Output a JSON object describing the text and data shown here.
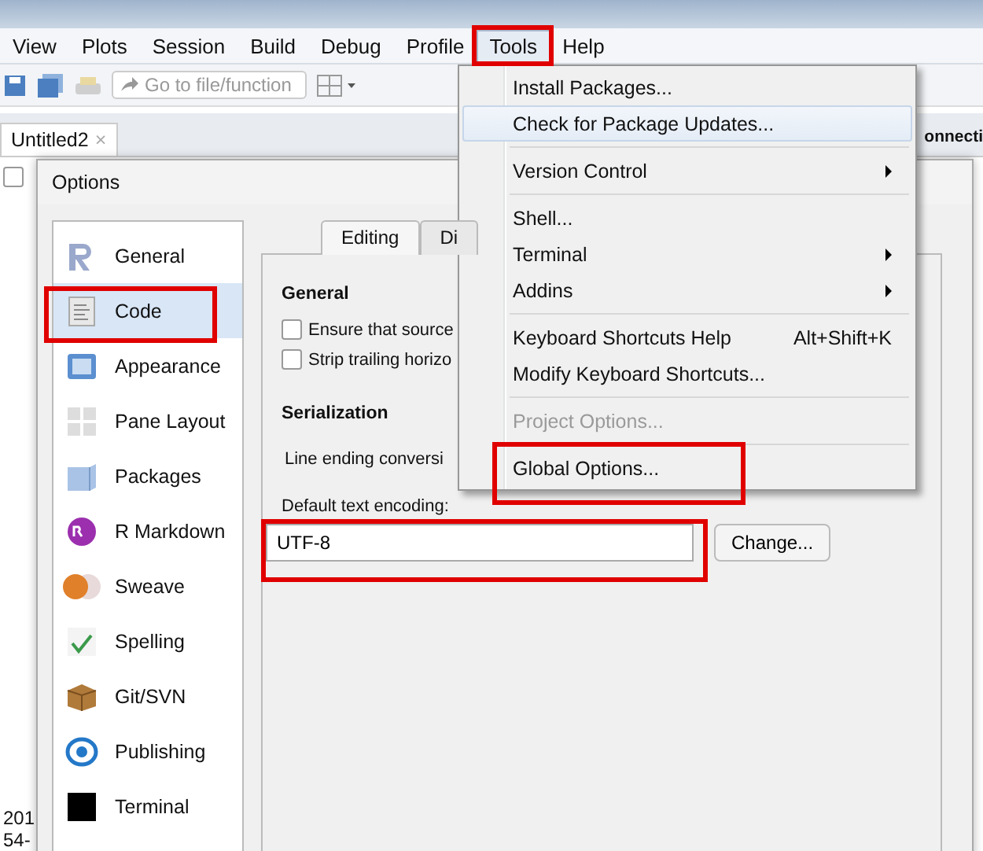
{
  "menubar": {
    "items": [
      {
        "label": "View",
        "selected": false,
        "highlighted": false
      },
      {
        "label": "Plots",
        "selected": false,
        "highlighted": false
      },
      {
        "label": "Session",
        "selected": false,
        "highlighted": false
      },
      {
        "label": "Build",
        "selected": false,
        "highlighted": false
      },
      {
        "label": "Debug",
        "selected": false,
        "highlighted": false
      },
      {
        "label": "Profile",
        "selected": false,
        "highlighted": false
      },
      {
        "label": "Tools",
        "selected": true,
        "highlighted": true
      },
      {
        "label": "Help",
        "selected": false,
        "highlighted": false
      }
    ]
  },
  "toolbar": {
    "goto_field": {
      "placeholder": "Go to file/function"
    }
  },
  "editor_tabs": [
    {
      "label": "Untitled2",
      "close": "×"
    }
  ],
  "right_pane_tab": "onnecti",
  "editor_row": {
    "checked": false
  },
  "console_fragments": [
    "201",
    "54-"
  ],
  "dialog": {
    "title": "Options",
    "sidebar": [
      {
        "label": "General",
        "kind": "general",
        "selected": false,
        "highlighted": false
      },
      {
        "label": "Code",
        "kind": "code",
        "selected": true,
        "highlighted": true
      },
      {
        "label": "Appearance",
        "kind": "appearance",
        "selected": false,
        "highlighted": false
      },
      {
        "label": "Pane Layout",
        "kind": "panes",
        "selected": false,
        "highlighted": false
      },
      {
        "label": "Packages",
        "kind": "packages",
        "selected": false,
        "highlighted": false
      },
      {
        "label": "R Markdown",
        "kind": "rmarkdown",
        "selected": false,
        "highlighted": false
      },
      {
        "label": "Sweave",
        "kind": "sweave",
        "selected": false,
        "highlighted": false
      },
      {
        "label": "Spelling",
        "kind": "spelling",
        "selected": false,
        "highlighted": false
      },
      {
        "label": "Git/SVN",
        "kind": "git",
        "selected": false,
        "highlighted": false
      },
      {
        "label": "Publishing",
        "kind": "publishing",
        "selected": false,
        "highlighted": false
      },
      {
        "label": "Terminal",
        "kind": "terminal",
        "selected": false,
        "highlighted": false
      }
    ],
    "tabs": [
      {
        "label": "Editing",
        "selected": true
      },
      {
        "label": "Di",
        "selected": false
      }
    ],
    "general_heading": "General",
    "checkboxes": [
      {
        "label": "Ensure that source",
        "checked": false
      },
      {
        "label": "Strip trailing horizo",
        "checked": false
      }
    ],
    "serialization_heading": "Serialization",
    "line_ending_label": "Line ending conversi",
    "encoding": {
      "label": "Default text encoding:",
      "value": "UTF-8",
      "highlighted": true
    },
    "change_button": "Change..."
  },
  "tools_menu": {
    "items": [
      {
        "kind": "item",
        "label": "Install Packages...",
        "selected": false,
        "submenu": false,
        "disabled": false,
        "highlighted": false
      },
      {
        "kind": "item",
        "label": "Check for Package Updates...",
        "selected": true,
        "submenu": false,
        "disabled": false,
        "highlighted": false
      },
      {
        "kind": "separator"
      },
      {
        "kind": "item",
        "label": "Version Control",
        "selected": false,
        "submenu": true,
        "disabled": false,
        "highlighted": false
      },
      {
        "kind": "separator"
      },
      {
        "kind": "item",
        "label": "Shell...",
        "selected": false,
        "submenu": false,
        "disabled": false,
        "highlighted": false
      },
      {
        "kind": "item",
        "label": "Terminal",
        "selected": false,
        "submenu": true,
        "disabled": false,
        "highlighted": false
      },
      {
        "kind": "item",
        "label": "Addins",
        "selected": false,
        "submenu": true,
        "disabled": false,
        "highlighted": false
      },
      {
        "kind": "separator"
      },
      {
        "kind": "item",
        "label": "Keyboard Shortcuts Help",
        "shortcut": "Alt+Shift+K",
        "selected": false,
        "submenu": false,
        "disabled": false,
        "highlighted": false
      },
      {
        "kind": "item",
        "label": "Modify Keyboard Shortcuts...",
        "selected": false,
        "submenu": false,
        "disabled": false,
        "highlighted": false
      },
      {
        "kind": "separator"
      },
      {
        "kind": "item",
        "label": "Project Options...",
        "selected": false,
        "submenu": false,
        "disabled": true,
        "highlighted": false
      },
      {
        "kind": "separator"
      },
      {
        "kind": "item",
        "label": "Global Options...",
        "selected": false,
        "submenu": false,
        "disabled": false,
        "highlighted": true
      }
    ]
  }
}
